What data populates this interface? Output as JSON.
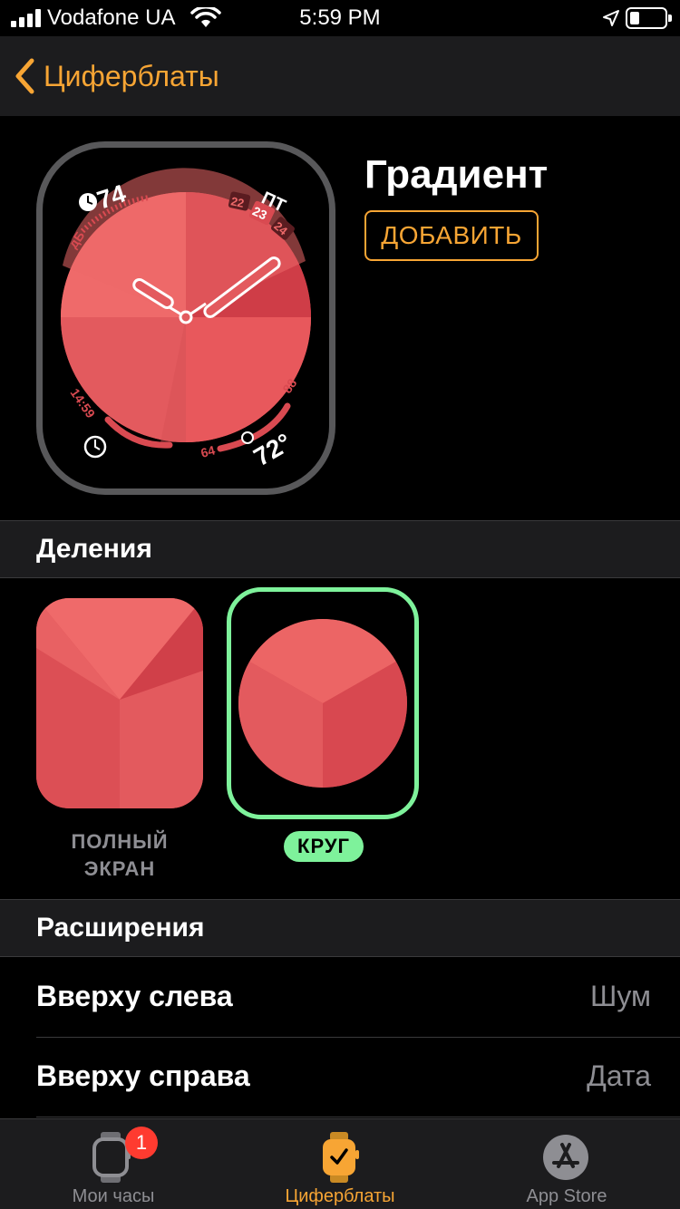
{
  "status_bar": {
    "carrier": "Vodafone UA",
    "time": "5:59 PM"
  },
  "nav": {
    "back_label": "Циферблаты"
  },
  "face": {
    "title": "Градиент",
    "add_button": "ДОБАВИТЬ",
    "complications": {
      "noise_value": "74",
      "noise_unit": "дБ",
      "date_weekday": "ПТ",
      "date_prev": "22",
      "date_current": "23",
      "date_next": "24",
      "timer": "14:59",
      "temp_high": "88",
      "temp_low": "64",
      "temp_current": "72°"
    },
    "colors": {
      "accent": "#f7a534",
      "gradient_light": "#ef6767",
      "gradient_dark": "#c8323f"
    }
  },
  "sections": {
    "dial": "Деления",
    "complications": "Расширения"
  },
  "dial_options": {
    "full_label_line1": "ПОЛНЫЙ",
    "full_label_line2": "ЭКРАН",
    "circle_label": "КРУГ",
    "selected": "КРУГ",
    "selected_color": "#7ef29b"
  },
  "complication_rows": [
    {
      "key": "Вверху слева",
      "value": "Шум"
    },
    {
      "key": "Вверху справа",
      "value": "Дата"
    }
  ],
  "tabs": [
    {
      "label": "Мои часы",
      "icon": "watch-icon",
      "badge": "1"
    },
    {
      "label": "Циферблаты",
      "icon": "watch-face-icon",
      "active": true
    },
    {
      "label": "App Store",
      "icon": "app-store-icon"
    }
  ]
}
